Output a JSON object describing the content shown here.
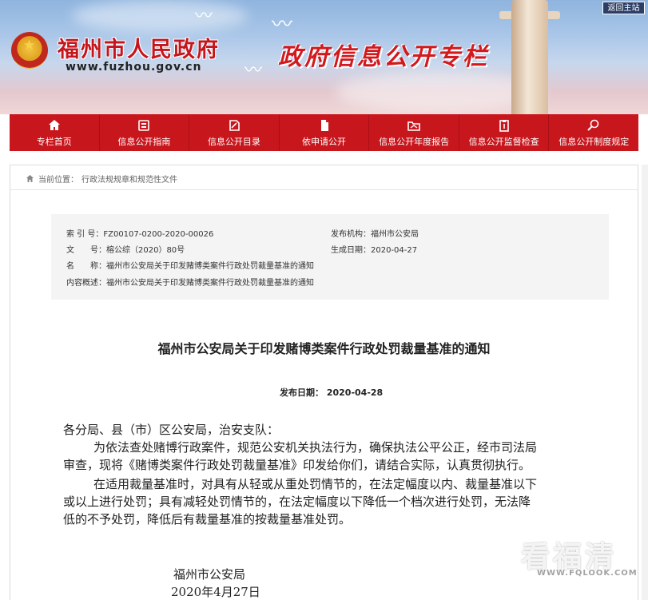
{
  "header": {
    "site_name": "福州市人民政府",
    "site_url": "www.fuzhou.gov.cn",
    "banner_title": "政府信息公开专栏",
    "back_label": "返回主站"
  },
  "nav": {
    "items": [
      {
        "label": "专栏首页",
        "icon": "home-icon"
      },
      {
        "label": "信息公开指南",
        "icon": "guide-icon"
      },
      {
        "label": "信息公开目录",
        "icon": "catalog-icon"
      },
      {
        "label": "依申请公开",
        "icon": "document-icon"
      },
      {
        "label": "信息公开年度报告",
        "icon": "folder-icon"
      },
      {
        "label": "信息公开监督检查",
        "icon": "clipboard-icon"
      },
      {
        "label": "信息公开制度规定",
        "icon": "search-icon"
      }
    ]
  },
  "breadcrumb": {
    "prefix": "当前位置：",
    "current": "行政法规规章和规范性文件"
  },
  "meta": {
    "index_label": "索 引 号：",
    "index_value": "FZ00107-0200-2020-00026",
    "doc_no_label": "文　　号：",
    "doc_no_value": "榕公综（2020）80号",
    "name_label": "名　　称：",
    "name_value": "福州市公安局关于印发赌博类案件行政处罚裁量基准的通知",
    "summary_label": "内容概述：",
    "summary_value": "福州市公安局关于印发赌博类案件行政处罚裁量基准的通知",
    "publisher_label": "发布机构：",
    "publisher_value": "福州市公安局",
    "date_label": "生成日期：",
    "date_value": "2020-04-27"
  },
  "document": {
    "title": "福州市公安局关于印发赌博类案件行政处罚裁量基准的通知",
    "publish_date": "发布日期：  2020-04-28",
    "salutation": "各分局、县（市）区公安局，治安支队：",
    "p1_line1": "为依法查处赌博行政案件，规范公安机关执法行为，确保执法公平公正，经市司法局",
    "p1_line2": "审查，现将《赌博类案件行政处罚裁量基准》印发给你们，请结合实际，认真贯彻执行。",
    "p2_line1": "在适用裁量基准时，对具有从轻或从重处罚情节的，在法定幅度以内、裁量基准以下",
    "p2_line2": "或以上进行处罚；具有减轻处罚情节的，在法定幅度以下降低一个档次进行处罚，无法降",
    "p2_line3": "低的不予处罚，降低后有裁量基准的按裁量基准处罚。",
    "signature": "福州市公安局",
    "sign_date": "2020年4月27日"
  },
  "watermark": {
    "text": "看福清",
    "url": "WWW.FQLOOK.COM"
  },
  "colors": {
    "nav_red": "#c8161d",
    "title_red": "#d21a1e"
  }
}
